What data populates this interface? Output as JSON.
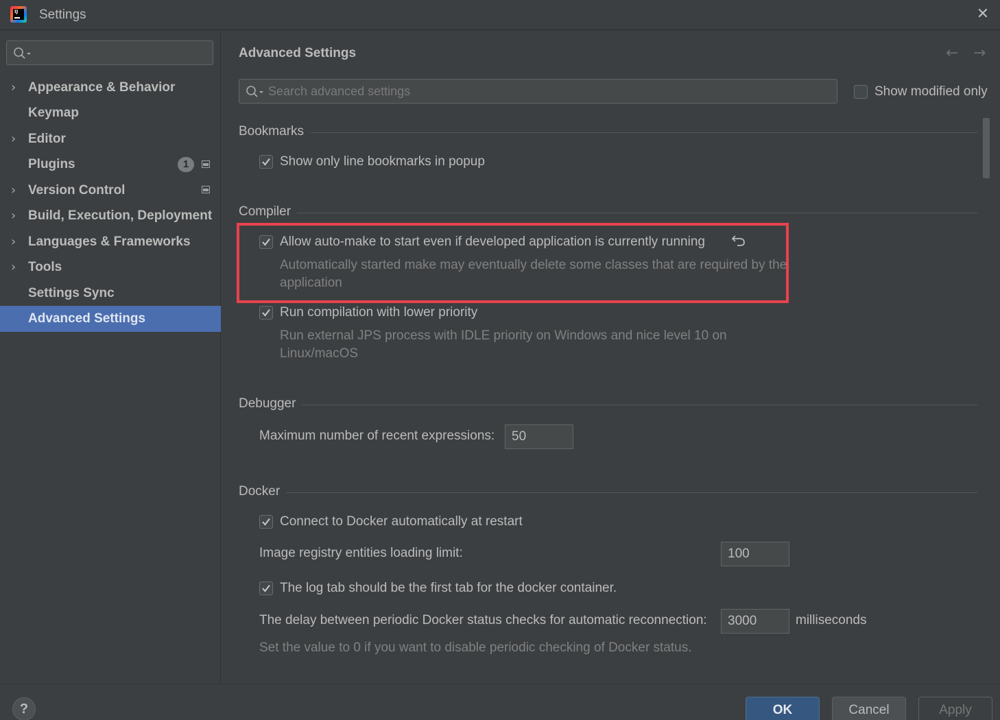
{
  "window": {
    "title": "Settings"
  },
  "sidebar": {
    "search_placeholder": "",
    "items": [
      {
        "label": "Appearance & Behavior",
        "expandable": true
      },
      {
        "label": "Keymap",
        "expandable": false
      },
      {
        "label": "Editor",
        "expandable": true
      },
      {
        "label": "Plugins",
        "expandable": false,
        "badge": "1"
      },
      {
        "label": "Version Control",
        "expandable": true
      },
      {
        "label": "Build, Execution, Deployment",
        "expandable": true
      },
      {
        "label": "Languages & Frameworks",
        "expandable": true
      },
      {
        "label": "Tools",
        "expandable": true
      },
      {
        "label": "Settings Sync",
        "expandable": false
      },
      {
        "label": "Advanced Settings",
        "expandable": false,
        "selected": true
      }
    ]
  },
  "main": {
    "title": "Advanced Settings",
    "search_placeholder": "Search advanced settings",
    "show_modified_label": "Show modified only",
    "sections": {
      "bookmarks": {
        "title": "Bookmarks",
        "option": "Show only line bookmarks in popup"
      },
      "compiler": {
        "title": "Compiler",
        "automake_label": "Allow auto-make to start even if developed application is currently running",
        "automake_desc": "Automatically started make may eventually delete some classes that are required by the application",
        "lowprio_label": "Run compilation with lower priority",
        "lowprio_desc": "Run external JPS process with IDLE priority on Windows and nice level 10 on Linux/macOS"
      },
      "debugger": {
        "title": "Debugger",
        "max_expr_label": "Maximum number of recent expressions:",
        "max_expr_value": "50"
      },
      "docker": {
        "title": "Docker",
        "autoconnect_label": "Connect to Docker automatically at restart",
        "registry_label": "Image registry entities loading limit:",
        "registry_value": "100",
        "logtab_label": "The log tab should be the first tab for the docker container.",
        "delay_label": "The delay between periodic Docker status checks for automatic reconnection:",
        "delay_value": "3000",
        "delay_unit": "milliseconds",
        "delay_hint": "Set the value to 0 if you want to disable periodic checking of Docker status."
      }
    }
  },
  "footer": {
    "help_label": "?",
    "ok_label": "OK",
    "cancel_label": "Cancel",
    "apply_label": "Apply"
  },
  "colors": {
    "background": "#3c3f41",
    "selection": "#4b6eaf",
    "highlight_border": "#e8424e",
    "ok_button": "#365880"
  },
  "icons": [
    "intellij-logo-icon",
    "close-icon",
    "search-icon",
    "chevron-right-icon",
    "project-level-icon",
    "back-arrow-icon",
    "forward-arrow-icon",
    "checkmark-icon",
    "reset-undo-icon",
    "help-icon"
  ]
}
